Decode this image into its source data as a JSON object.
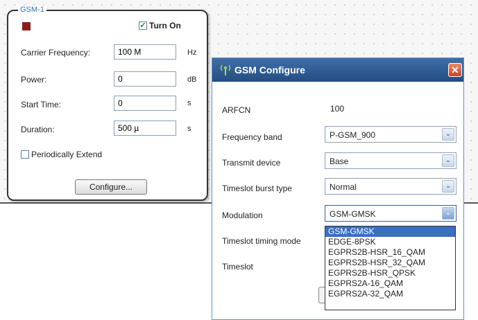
{
  "gsm_panel": {
    "legend": "GSM-1",
    "turn_on": {
      "label": "Turn On",
      "checked": true
    },
    "fields": [
      {
        "label": "Carrier Frequency:",
        "value": "100 M",
        "unit": "Hz"
      },
      {
        "label": "Power:",
        "value": "0",
        "unit": "dB"
      },
      {
        "label": "Start Time:",
        "value": "0",
        "unit": "s"
      },
      {
        "label": "Duration:",
        "value": "500 µ",
        "unit": "s"
      }
    ],
    "periodically_extend": {
      "label": "Periodically Extend",
      "checked": false
    },
    "configure_label": "Configure..."
  },
  "dialog": {
    "title": "GSM Configure",
    "close_glyph": "✕",
    "arfcn": {
      "label": "ARFCN",
      "value": "100"
    },
    "frequency_band": {
      "label": "Frequency band",
      "value": "P-GSM_900"
    },
    "transmit_device": {
      "label": "Transmit device",
      "value": "Base"
    },
    "timeslot_burst_type": {
      "label": "Timeslot burst type",
      "value": "Normal"
    },
    "modulation": {
      "label": "Modulation",
      "value": "GSM-GMSK",
      "options": [
        "GSM-GMSK",
        "EDGE-8PSK",
        "EGPRS2B-HSR_16_QAM",
        "EGPRS2B-HSR_32_QAM",
        "EGPRS2B-HSR_QPSK",
        "EGPRS2A-16_QAM",
        "EGPRS2A-32_QAM"
      ]
    },
    "timeslot_timing_mode": {
      "label": "Timeslot timing mode"
    },
    "timeslot": {
      "label": "Timeslot"
    },
    "arrow_glyph": "⌄"
  },
  "colors": {
    "titlebar": "#2f5c93",
    "selection": "#3a6fc0",
    "close_button": "#d4553a",
    "legend_text": "#3a6fb8"
  }
}
